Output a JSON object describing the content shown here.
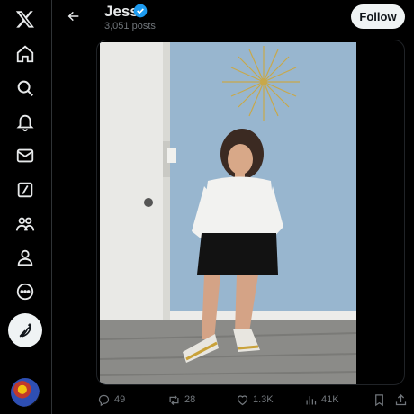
{
  "profile": {
    "name": "Jess",
    "posts_count": "3,051 posts",
    "follow_label": "Follow"
  },
  "nav": {
    "items": [
      "x-logo",
      "home-icon",
      "search-icon",
      "notifications-icon",
      "messages-icon",
      "grok-icon",
      "communities-icon",
      "profile-icon",
      "more-icon"
    ]
  },
  "post": {
    "replies": "49",
    "reposts": "28",
    "likes": "1.3K",
    "views": "41K"
  },
  "colors": {
    "accent": "#1d9bf0",
    "background": "#000000",
    "text": "#e7e9ea",
    "muted": "#71767b",
    "follow_bg": "#eff3f4"
  }
}
